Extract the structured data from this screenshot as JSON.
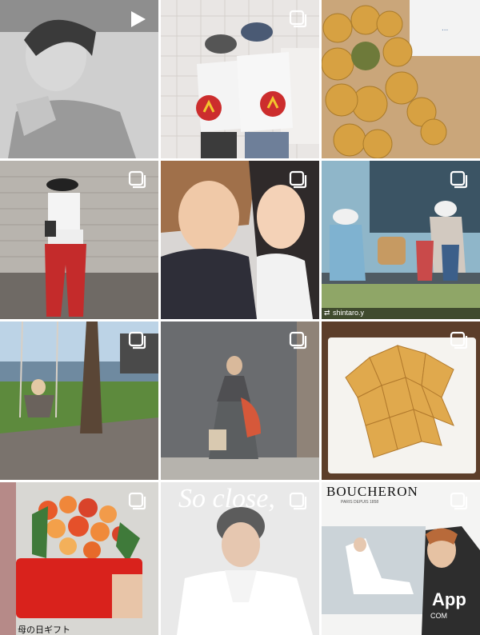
{
  "posts": [
    {
      "type": "video",
      "icon": "play-icon"
    },
    {
      "type": "carousel",
      "icon": "multiple-photos-icon"
    },
    {
      "type": "photo",
      "overlay_text": "..."
    },
    {
      "type": "carousel",
      "icon": "multiple-photos-icon"
    },
    {
      "type": "carousel",
      "icon": "multiple-photos-icon"
    },
    {
      "type": "carousel",
      "icon": "multiple-photos-icon",
      "repost_username": "shintaro.y"
    },
    {
      "type": "carousel",
      "icon": "multiple-photos-icon"
    },
    {
      "type": "carousel",
      "icon": "multiple-photos-icon"
    },
    {
      "type": "carousel",
      "icon": "multiple-photos-icon"
    },
    {
      "type": "carousel",
      "icon": "multiple-photos-icon",
      "caption": "母の日ギフト"
    },
    {
      "type": "carousel",
      "icon": "multiple-photos-icon",
      "headline": "So close,"
    },
    {
      "type": "carousel",
      "icon": "multiple-photos-icon",
      "brand": "BOUCHERON",
      "brand_sub": "PARIS DEPUIS 1858",
      "watermark": "App",
      "watermark_sub": "COM"
    }
  ],
  "colors": {
    "divider": "#ffffff",
    "badge": "#ffffff"
  }
}
